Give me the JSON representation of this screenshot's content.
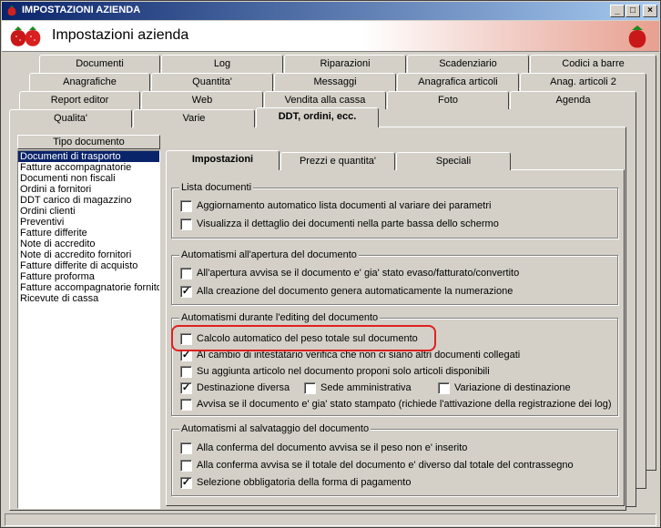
{
  "window": {
    "title": "IMPOSTAZIONI AZIENDA",
    "controls": {
      "minimize": "_",
      "maximize": "□",
      "close": "×"
    }
  },
  "header": {
    "title": "Impostazioni azienda"
  },
  "tabs": {
    "row1": [
      "Documenti",
      "Log",
      "Riparazioni",
      "Scadenziario",
      "Codici a barre"
    ],
    "row2": [
      "Anagrafiche",
      "Quantita'",
      "Messaggi",
      "Anagrafica articoli",
      "Anag. articoli 2"
    ],
    "row3": [
      "Report editor",
      "Web",
      "Vendita alla cassa",
      "Foto",
      "Agenda"
    ],
    "row4": [
      "Qualita'",
      "Varie",
      "DDT, ordini, ecc."
    ]
  },
  "doclist": {
    "header": "Tipo documento",
    "items": [
      "Documenti di trasporto",
      "Fatture accompagnatorie",
      "Documenti non fiscali",
      "Ordini a fornitori",
      "DDT carico di magazzino",
      "Ordini clienti",
      "Preventivi",
      "Fatture differite",
      "Note di accredito",
      "Note di accredito fornitori",
      "Fatture differite di acquisto",
      "Fatture proforma",
      "Fatture accompagnatorie fornitori",
      "Ricevute di cassa"
    ]
  },
  "innertabs": [
    "Impostazioni",
    "Prezzi e quantita'",
    "Speciali"
  ],
  "groups": {
    "lista": {
      "title": "Lista documenti",
      "options": [
        {
          "label": "Aggiornamento automatico lista documenti al variare dei parametri",
          "checked": false
        },
        {
          "label": "Visualizza il dettaglio dei documenti nella parte bassa dello schermo",
          "checked": false
        }
      ]
    },
    "apertura": {
      "title": "Automatismi all'apertura del documento",
      "options": [
        {
          "label": "All'apertura avvisa se il documento e' gia' stato evaso/fatturato/convertito",
          "checked": false
        },
        {
          "label": "Alla creazione del documento genera automaticamente la numerazione",
          "checked": true
        }
      ]
    },
    "editing": {
      "title": "Automatismi durante l'editing del documento",
      "options": [
        {
          "label": "Calcolo automatico del peso totale sul documento",
          "checked": false
        },
        {
          "label": "Al cambio di intestatario verifica che non ci siano altri documenti collegati",
          "checked": true
        },
        {
          "label": "Su aggiunta articolo nel documento proponi solo articoli disponibili",
          "checked": false
        },
        {
          "label": "Destinazione diversa",
          "checked": true
        },
        {
          "label": "Sede amministrativa",
          "checked": false
        },
        {
          "label": "Variazione di destinazione",
          "checked": false
        },
        {
          "label": "Avvisa se il documento e' gia' stato stampato (richiede l'attivazione della registrazione dei log)",
          "checked": false
        }
      ]
    },
    "salvataggio": {
      "title": "Automatismi al salvataggio del documento",
      "options": [
        {
          "label": "Alla conferma del documento avvisa se il peso non e' inserito",
          "checked": false
        },
        {
          "label": "Alla conferma avvisa se il totale del documento e' diverso dal totale del contrassegno",
          "checked": false
        },
        {
          "label": "Selezione obbligatoria della forma di pagamento",
          "checked": true
        }
      ]
    }
  },
  "colors": {
    "title_start": "#0a246a",
    "title_end": "#a6caf0",
    "highlight": "#e02020",
    "selection": "#0a246a"
  }
}
